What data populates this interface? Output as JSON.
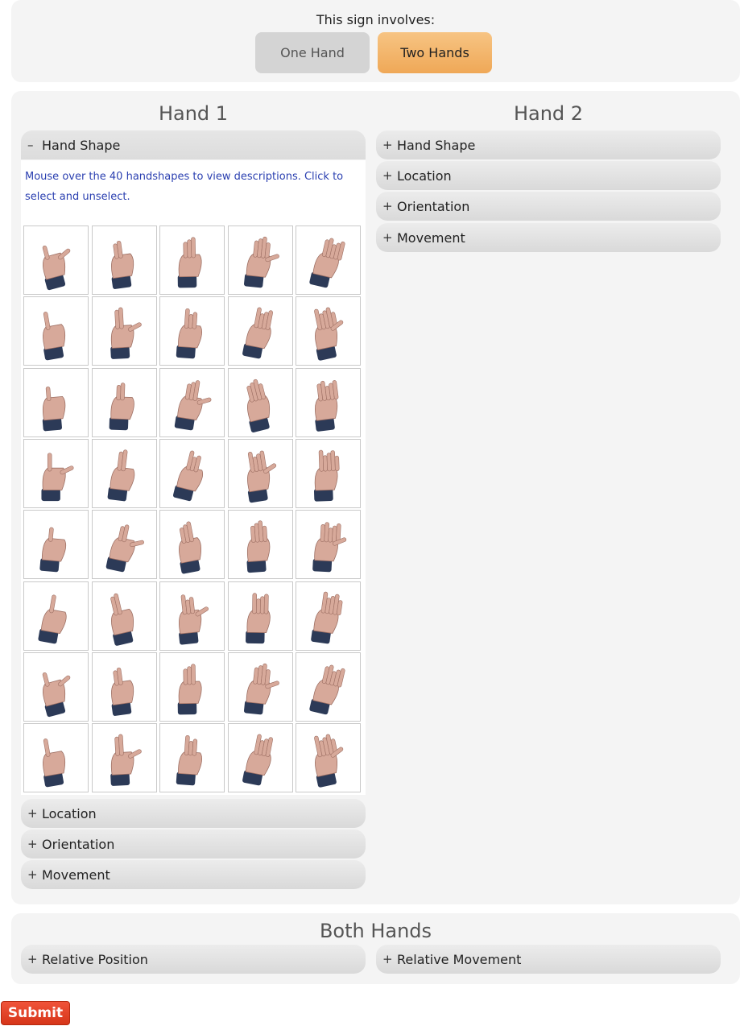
{
  "sign_question": {
    "label": "This sign involves:",
    "options": [
      "One Hand",
      "Two Hands"
    ],
    "selected": "Two Hands"
  },
  "hand1": {
    "title": "Hand 1",
    "sections": [
      {
        "label": "Hand Shape",
        "symbol": "–",
        "expanded": true
      },
      {
        "label": "Location",
        "symbol": "+",
        "expanded": false
      },
      {
        "label": "Orientation",
        "symbol": "+",
        "expanded": false
      },
      {
        "label": "Movement",
        "symbol": "+",
        "expanded": false
      }
    ],
    "handshape_help": "Mouse over the 40 handshapes to view descriptions. Click to select and unselect.",
    "handshape_count": 40
  },
  "hand2": {
    "title": "Hand 2",
    "sections": [
      {
        "label": "Hand Shape",
        "symbol": "+",
        "expanded": false
      },
      {
        "label": "Location",
        "symbol": "+",
        "expanded": false
      },
      {
        "label": "Orientation",
        "symbol": "+",
        "expanded": false
      },
      {
        "label": "Movement",
        "symbol": "+",
        "expanded": false
      }
    ]
  },
  "both_hands": {
    "title": "Both Hands",
    "sections": [
      {
        "label": "Relative Position",
        "symbol": "+"
      },
      {
        "label": "Relative Movement",
        "symbol": "+"
      }
    ]
  },
  "submit_label": "Submit",
  "colors": {
    "selected_button": "#f2b266",
    "unselected_button": "#d4d4d4",
    "submit": "#e0452a",
    "help_text": "#2a3fb0",
    "panel": "#f4f4f4",
    "skin": "#d7a99a",
    "sleeve": "#2c3a57"
  }
}
